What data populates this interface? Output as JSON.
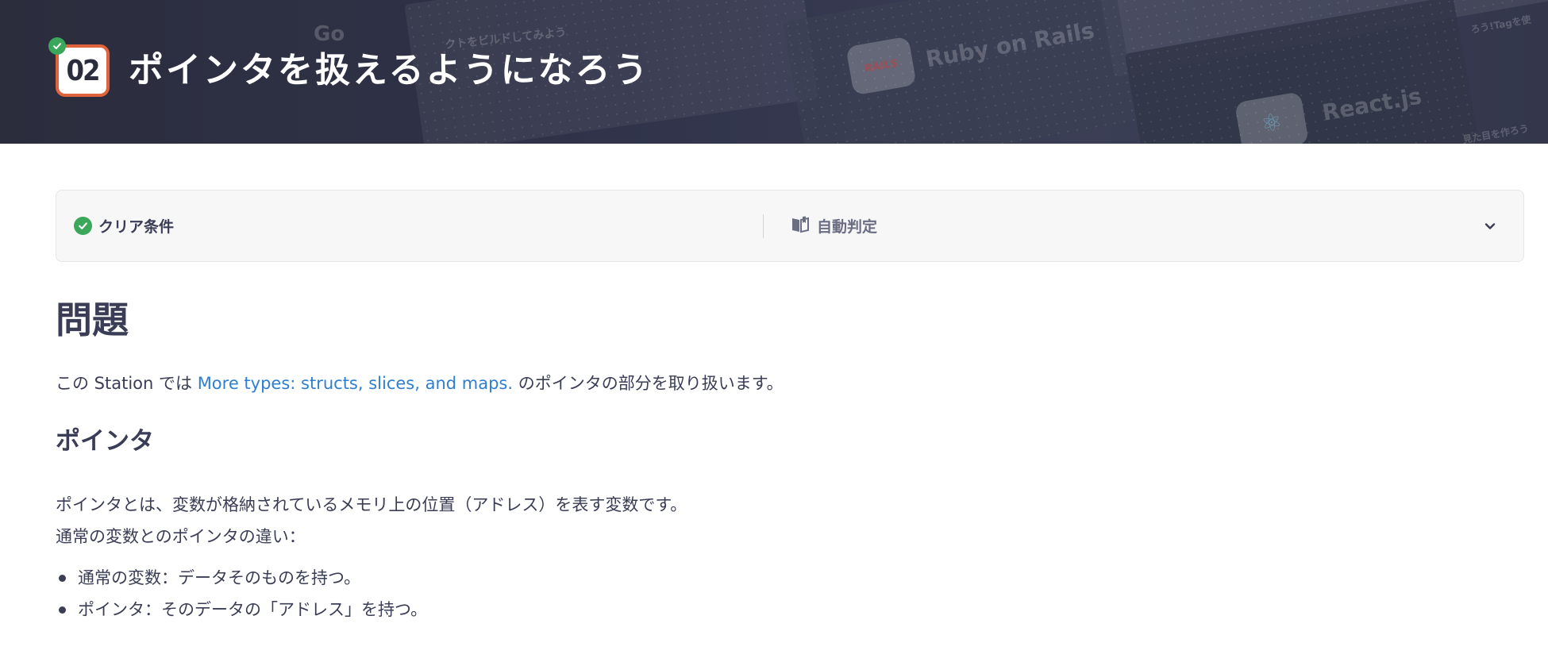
{
  "header": {
    "station_number": "02",
    "title": "ポインタを扱えるようになろう",
    "background_texts": [
      "Go",
      "クトをビルドしてみよう",
      "Ruby on Rails",
      "React.js",
      "見た目を作ろう",
      "ろう!Tagを使"
    ],
    "background_logo_text": "RAILS"
  },
  "clear_condition": {
    "label": "クリア条件",
    "judge_label": "自動判定"
  },
  "content": {
    "heading": "問題",
    "intro_prefix": "この Station では ",
    "intro_link": "More types: structs, slices, and maps.",
    "intro_suffix": " のポインタの部分を取り扱います。",
    "section_heading": "ポインタ",
    "definition_line1": "ポインタとは、変数が格納されているメモリ上の位置（アドレス）を表す変数です。",
    "definition_line2": "通常の変数とのポインタの違い：",
    "differences": [
      "通常の変数：データそのものを持つ。",
      "ポインタ：そのデータの「アドレス」を持つ。"
    ]
  },
  "colors": {
    "accent_orange": "#e0643b",
    "success_green": "#3aa75a",
    "link_blue": "#2e7fd0",
    "header_bg": "#2b2d3d",
    "text": "#3a3d55"
  },
  "icons": [
    "check-icon",
    "book-icon",
    "chevron-down-icon"
  ]
}
